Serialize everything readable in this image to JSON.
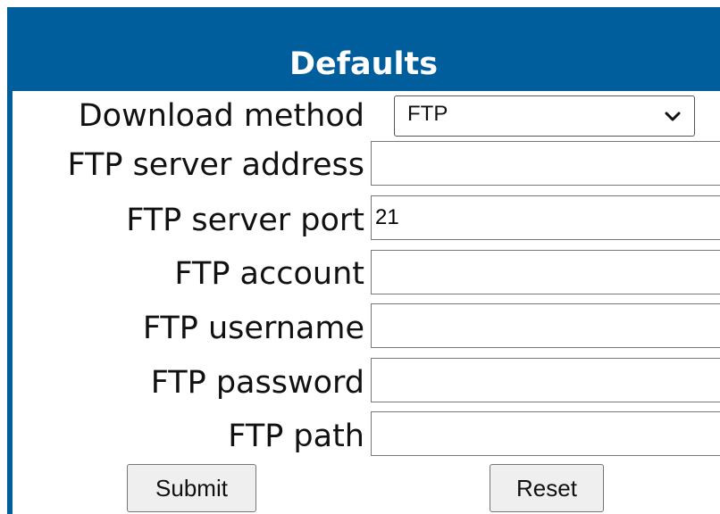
{
  "header": {
    "title": "Defaults"
  },
  "form": {
    "download_method": {
      "label": "Download method",
      "value": "FTP"
    },
    "server_address": {
      "label": "FTP server address",
      "value": ""
    },
    "server_port": {
      "label": "FTP server port",
      "value": "21"
    },
    "account": {
      "label": "FTP account",
      "value": ""
    },
    "username": {
      "label": "FTP username",
      "value": ""
    },
    "password": {
      "label": "FTP password",
      "value": ""
    },
    "path": {
      "label": "FTP path",
      "value": ""
    }
  },
  "buttons": {
    "submit_label": "Submit",
    "reset_label": "Reset"
  },
  "colors": {
    "header_bg": "#005e9c",
    "header_text": "#ffffff",
    "button_bg": "#efefef"
  },
  "icons": {
    "select_arrow": "chevron-down-icon"
  }
}
